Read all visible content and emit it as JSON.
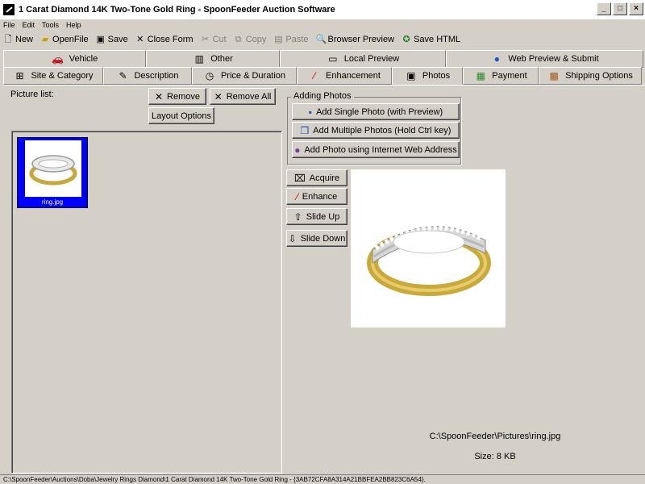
{
  "window": {
    "title": "1 Carat Diamond 14K Two-Tone Gold Ring - SpoonFeeder Auction Software",
    "controls": [
      "_",
      "□",
      "×"
    ]
  },
  "menu": [
    "File",
    "Edit",
    "Tools",
    "Help"
  ],
  "toolbar": {
    "new": "New",
    "open": "OpenFile",
    "save": "Save",
    "close": "Close Form",
    "cut": "Cut",
    "copy": "Copy",
    "paste": "Paste",
    "browser_preview": "Browser Preview",
    "save_html": "Save HTML"
  },
  "tabs_top": [
    {
      "label": "Vehicle",
      "icon": "car-icon"
    },
    {
      "label": "Other",
      "icon": "barcode-icon"
    },
    {
      "label": "Local Preview",
      "icon": "monitor-icon"
    },
    {
      "label": "Web Preview & Submit",
      "icon": "globe-icon"
    }
  ],
  "tabs_bottom": [
    {
      "label": "Site & Category",
      "icon": "tree-icon"
    },
    {
      "label": "Description",
      "icon": "pencil-icon"
    },
    {
      "label": "Price & Duration",
      "icon": "clock-icon"
    },
    {
      "label": "Enhancement",
      "icon": "wand-icon"
    },
    {
      "label": "Photos",
      "icon": "camera-icon",
      "active": true
    },
    {
      "label": "Payment",
      "icon": "money-icon"
    },
    {
      "label": "Shipping Options",
      "icon": "box-icon"
    }
  ],
  "photos": {
    "picture_list_label": "Picture list:",
    "remove": "Remove",
    "remove_all": "Remove All",
    "layout_options": "Layout Options",
    "thumbnail_name": "ring.jpg",
    "adding_photos_legend": "Adding Photos",
    "add_single": "Add Single Photo (with Preview)",
    "add_multiple": "Add Multiple Photos (Hold Ctrl key)",
    "add_web": "Add Photo using Internet Web Address",
    "acquire": "Acquire",
    "enhance": "Enhance",
    "slide_up": "Slide Up",
    "slide_down": "Slide Down",
    "file_path": "C:\\SpoonFeeder\\Pictures\\ring.jpg",
    "file_size": "Size: 8 KB"
  },
  "status_bar": "C:\\SpoonFeeder\\Auctions\\Doba\\Jewelry Rings Diamond\\1 Carat Diamond 14K Two-Tone Gold Ring - {3AB72CFA8A314A21BBFEA2BB823C6A54}."
}
